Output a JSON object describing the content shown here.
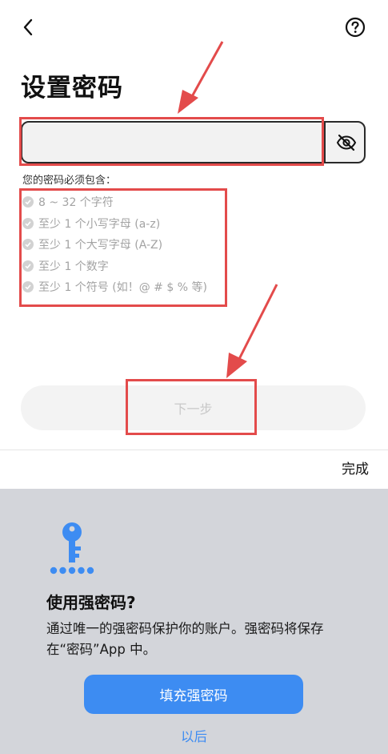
{
  "header": {
    "back_icon": "chevron-left-icon",
    "help_icon": "question-circle-icon"
  },
  "page": {
    "title": "设置密码"
  },
  "password_field": {
    "value": "",
    "toggle_icon": "eye-slash-icon"
  },
  "requirements": {
    "title": "您的密码必须包含：",
    "items": [
      "8 ~ 32 个字符",
      "至少 1 个小写字母 (a-z)",
      "至少 1 个大写字母 (A-Z)",
      "至少 1 个数字",
      "至少 1 个符号 (如！@ # $ % 等)"
    ]
  },
  "next_button": {
    "label": "下一步"
  },
  "keyboard_bar": {
    "done_label": "完成"
  },
  "strong_password_sheet": {
    "icon": "key-icon",
    "title": "使用强密码?",
    "description": "通过唯一的强密码保护你的账户。强密码将保存在“密码”App 中。",
    "fill_button": "填充强密码",
    "later_link": "以后"
  },
  "colors": {
    "annotation_red": "#e34b4b",
    "accent_blue": "#3d8cf2",
    "sheet_bg": "#d3d5da"
  }
}
